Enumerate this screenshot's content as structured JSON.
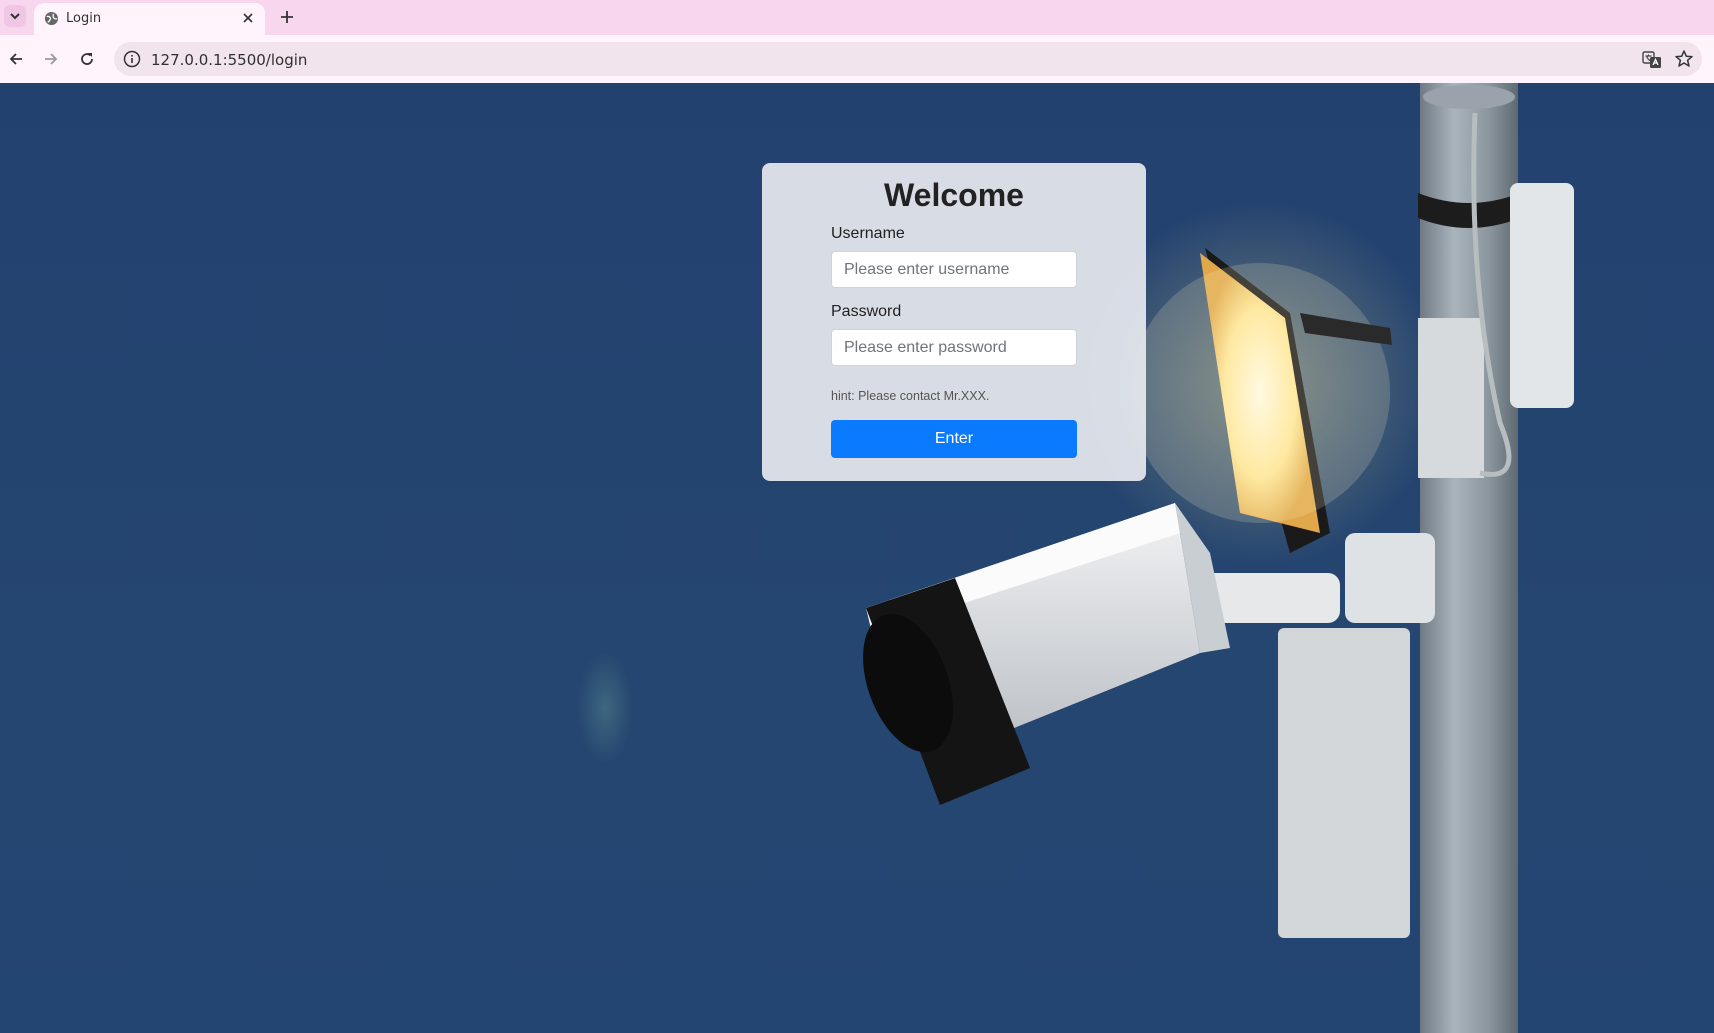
{
  "browser": {
    "tab": {
      "title": "Login"
    },
    "address": {
      "url": "127.0.0.1:5500/login"
    },
    "icons": [
      "tab-list-icon",
      "globe-icon",
      "close-icon",
      "plus-icon",
      "back-icon",
      "forward-icon",
      "reload-icon",
      "info-icon",
      "translate-icon",
      "star-icon"
    ]
  },
  "login": {
    "title": "Welcome",
    "username_label": "Username",
    "username_placeholder": "Please enter username",
    "password_label": "Password",
    "password_placeholder": "Please enter password",
    "hint": "hint: Please contact Mr.XXX.",
    "submit_label": "Enter"
  },
  "colors": {
    "accent": "#0a7bff",
    "tabbar": "#f8d7ee",
    "background": "#23416f"
  }
}
